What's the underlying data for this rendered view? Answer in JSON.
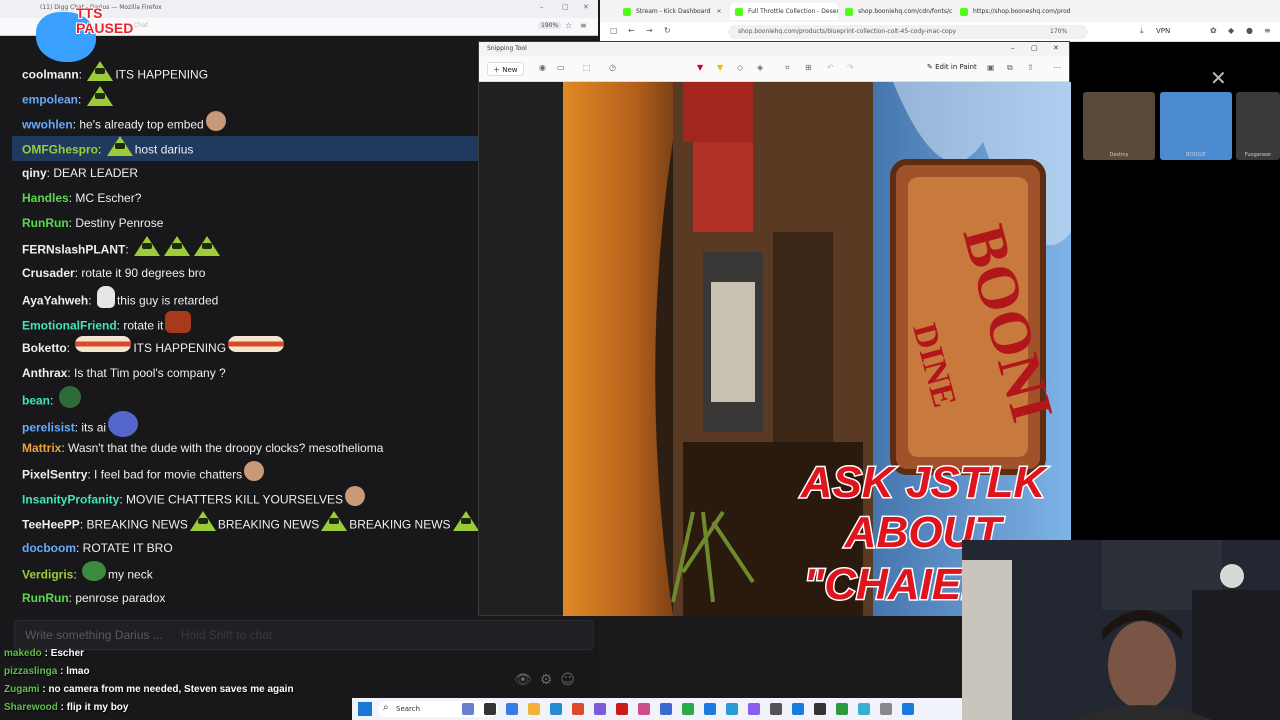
{
  "left_window": {
    "title": "(11) Digg Chat - Darius — Mozilla Firefox",
    "zoom": "190%",
    "url_hint": "Digg Chat"
  },
  "tts": {
    "line1": "TTS",
    "line2": "PAUSED"
  },
  "chat": {
    "messages": [
      {
        "user": "coolmann",
        "color": "#efeff1",
        "text": "ITS HAPPENING",
        "emotes_before": [
          "pepe-triangle-icon"
        ]
      },
      {
        "user": "empolean",
        "color": "#66aaff",
        "text": "",
        "emotes_before": [
          "pepe-triangle-icon"
        ]
      },
      {
        "user": "wwohlen",
        "color": "#66aaff",
        "text": "he's already top embed",
        "emotes_after": [
          "face-emote-icon"
        ]
      },
      {
        "user": "OMFGhespro",
        "color": "#9ccc3a",
        "text": "host darius",
        "emotes_before": [
          "pepe-triangle-icon"
        ],
        "highlight": true
      },
      {
        "user": "qiny",
        "color": "#efeff1",
        "text": "DEAR LEADER"
      },
      {
        "user": "Handles",
        "color": "#59d94f",
        "text": "MC Escher?"
      },
      {
        "user": "RunRun",
        "color": "#59d94f",
        "text": "Destiny Penrose"
      },
      {
        "user": "FERNslashPLANT",
        "color": "#efeff1",
        "text": "",
        "emotes_before": [
          "pepe-triangle-icon",
          "pepe-triangle-icon",
          "pepe-triangle-icon"
        ]
      },
      {
        "user": "Crusader",
        "color": "#efeff1",
        "text": "rotate it 90 degrees bro"
      },
      {
        "user": "AyaYahweh",
        "color": "#efeff1",
        "text": "this guy is retarded",
        "emotes_before": [
          "skull-emote-icon"
        ]
      },
      {
        "user": "EmotionalFriend",
        "color": "#3ee6b8",
        "text": "rotate it",
        "emotes_after": [
          "red-emote-icon"
        ]
      },
      {
        "user": "Boketto",
        "color": "#efeff1",
        "text": "ITS HAPPENING",
        "emotes_before": [
          "burger-emote-icon"
        ],
        "emotes_after": [
          "burger-emote-icon"
        ]
      },
      {
        "user": "Anthrax",
        "color": "#efeff1",
        "text": "Is that Tim pool's company ?"
      },
      {
        "user": "bean",
        "color": "#3ee6b8",
        "text": "",
        "emotes_before": [
          "alien-emote-icon"
        ]
      },
      {
        "user": "perelisist",
        "color": "#66aaff",
        "text": "its ai",
        "emotes_after": [
          "blob-emote-icon"
        ]
      },
      {
        "user": "Mattrix",
        "color": "#e8a23a",
        "text": "Wasn't that the dude with the droopy clocks? mesothelioma"
      },
      {
        "user": "PixelSentry",
        "color": "#efeff1",
        "text": "I feel bad for movie chatters",
        "emotes_after": [
          "face-emote-icon"
        ]
      },
      {
        "user": "InsanityProfanity",
        "color": "#3ee6b8",
        "text": "MOVIE CHATTERS KILL YOURSELVES",
        "emotes_after": [
          "face-emote-icon"
        ]
      },
      {
        "user": "TeeHeePP",
        "color": "#efeff1",
        "text": "BREAKING NEWS",
        "repeat_text": [
          "BREAKING NEWS",
          "BREAKING NEWS"
        ],
        "emotes_after": [
          "pepe-triangle-icon"
        ]
      },
      {
        "user": "docboom",
        "color": "#66aaff",
        "text": "ROTATE IT BRO"
      },
      {
        "user": "Verdigris",
        "color": "#9ccc3a",
        "text": "my neck",
        "emotes_before": [
          "frog-emote-icon"
        ]
      },
      {
        "user": "RunRun",
        "color": "#59d94f",
        "text": "penrose paradox"
      }
    ],
    "partial_top_user": "ee",
    "input_placeholder": "Write something Darius ...",
    "input_hint": "Hold Shift to chat"
  },
  "overlay_chat": [
    {
      "user": "makedo",
      "text": "Escher"
    },
    {
      "user": "pizzaslinga",
      "text": "lmao"
    },
    {
      "user": "Zugami",
      "text": "no camera from me needed, Steven saves me again"
    },
    {
      "user": "Sharewood",
      "text": "flip it my boy"
    }
  ],
  "right_window": {
    "tabs": [
      {
        "label": "Stream - Kick Dashboard",
        "active": false
      },
      {
        "label": "Full Throttle Collection - Desert Rus",
        "active": true
      },
      {
        "label": "shop.booniehq.com/cdn/fonts/coo",
        "active": false
      },
      {
        "label": "https://shop.booneshq.com/produ",
        "active": false
      }
    ],
    "url": "shop.booniehq.com/products/blueprint-collection-colt-45-cody-mac-copy",
    "zoom": "170%",
    "vpn": "VPN",
    "thumbs": [
      {
        "label": "Destiny",
        "color": "#5a4a3a"
      },
      {
        "label": "BOOGIE",
        "color": "#4a8ad0"
      },
      {
        "label": "Fuoganeer",
        "color": "#3a3a3a"
      }
    ]
  },
  "snipping_tool": {
    "title": "Snipping Tool",
    "new_label": "New",
    "edit_label": "Edit in Paint",
    "image": {
      "caption_lines": [
        "ASK JSTLK",
        "ABOUT",
        "\"CHAIERY\""
      ],
      "sign_text": "BOONI",
      "sign_sub": "DINE"
    }
  },
  "taskbar": {
    "search_label": "Search"
  },
  "colors": {
    "accent_green": "#9ccc3a",
    "highlight_row": "#1f3a5c",
    "caption_red": "#e0141c",
    "tts_red": "#e8232a"
  }
}
